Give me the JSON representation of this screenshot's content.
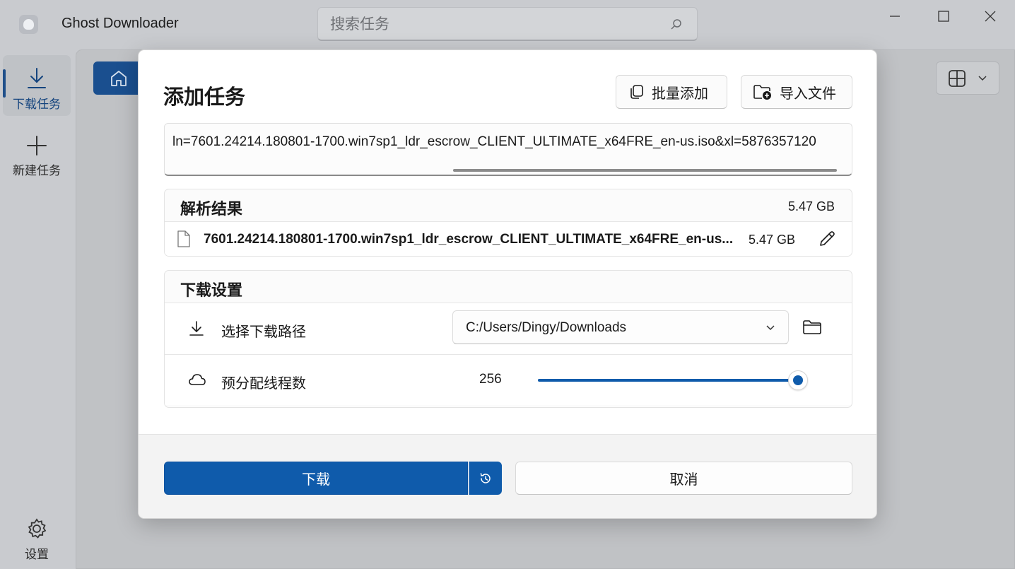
{
  "app": {
    "title": "Ghost Downloader"
  },
  "search": {
    "placeholder": "搜索任务"
  },
  "sidebar": {
    "items": [
      {
        "label": "下载任务",
        "icon": "download-icon",
        "active": true
      },
      {
        "label": "新建任务",
        "icon": "plus-icon",
        "active": false
      }
    ],
    "settings_label": "设置"
  },
  "dialog": {
    "title": "添加任务",
    "batch_add_label": "批量添加",
    "import_file_label": "导入文件",
    "url_value": "ln=7601.24214.180801-1700.win7sp1_ldr_escrow_CLIENT_ULTIMATE_x64FRE_en-us.iso&xl=5876357120",
    "parse": {
      "title": "解析结果",
      "total_size": "5.47 GB",
      "files": [
        {
          "name": "7601.24214.180801-1700.win7sp1_ldr_escrow_CLIENT_ULTIMATE_x64FRE_en-us...",
          "size": "5.47 GB"
        }
      ]
    },
    "settings": {
      "title": "下载设置",
      "path_label": "选择下载路径",
      "path_value": "C:/Users/Dingy/Downloads",
      "threads_label": "预分配线程数",
      "threads_value": "256",
      "threads_level": 1.0
    },
    "download_label": "下载",
    "cancel_label": "取消"
  },
  "colors": {
    "accent": "#0f5bab",
    "overlay": "#c9cbcf",
    "dialog_bg": "#ffffff",
    "footer_bg": "#f3f3f3"
  }
}
